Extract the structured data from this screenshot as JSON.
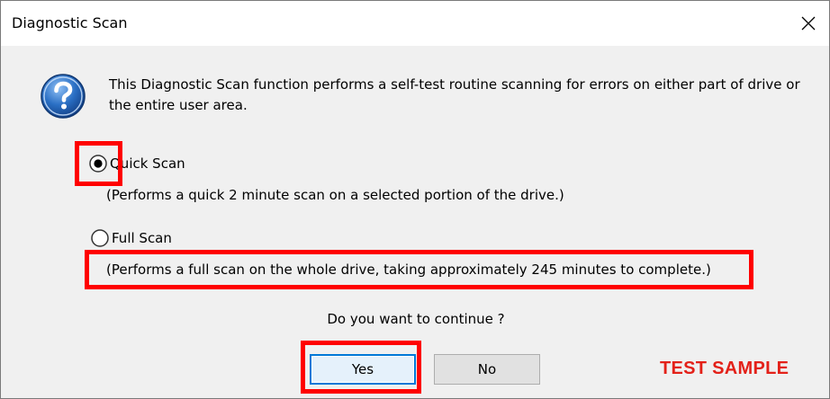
{
  "window": {
    "title": "Diagnostic Scan",
    "close_icon": "close-icon"
  },
  "message": {
    "icon": "question-icon",
    "text": "This Diagnostic Scan function performs a self-test routine scanning for errors on either part of drive or the entire user area."
  },
  "options": [
    {
      "label": "Quick Scan",
      "selected": true,
      "description": "(Performs a quick 2 minute scan on a selected portion of the drive.)"
    },
    {
      "label": "Full Scan",
      "selected": false,
      "description": "(Performs a full scan on the whole drive, taking approximately  245 minutes to complete.)"
    }
  ],
  "prompt": "Do you want to continue ?",
  "buttons": {
    "yes_label": "Yes",
    "no_label": "No"
  },
  "watermark": "TEST SAMPLE",
  "colors": {
    "highlight": "#ff0000",
    "watermark": "#e32119",
    "focus": "#0078d7",
    "icon_blue": "#2a6fc4"
  }
}
